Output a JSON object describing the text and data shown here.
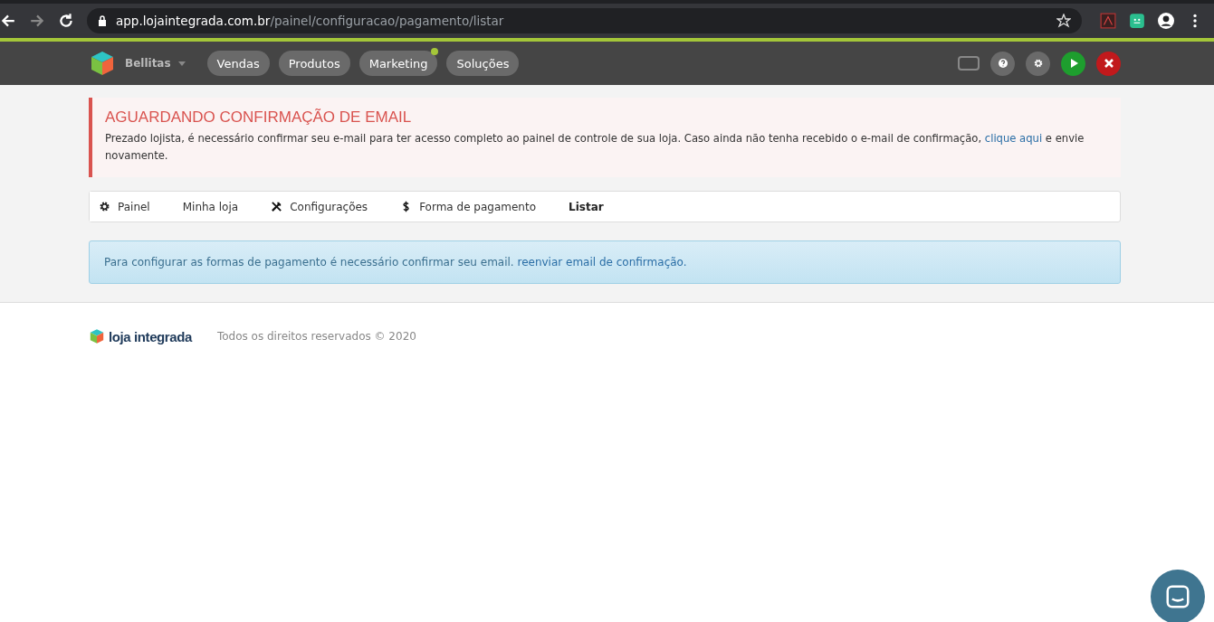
{
  "browser": {
    "url_host": "app.lojaintegrada.com.br",
    "url_path": "/painel/configuracao/pagamento/listar"
  },
  "header": {
    "store_name": "Bellitas",
    "nav": [
      {
        "label": "Vendas",
        "notification": false
      },
      {
        "label": "Produtos",
        "notification": false
      },
      {
        "label": "Marketing",
        "notification": true
      },
      {
        "label": "Soluções",
        "notification": false
      }
    ],
    "actions": [
      {
        "kind": "screen"
      },
      {
        "kind": "help"
      },
      {
        "kind": "settings"
      },
      {
        "kind": "play"
      },
      {
        "kind": "close"
      }
    ]
  },
  "alert": {
    "title": "AGUARDANDO CONFIRMAÇÃO DE EMAIL",
    "text": "Prezado lojista, é necessário confirmar seu e-mail para ter acesso completo ao painel de controle de sua loja. Caso ainda não tenha recebido o e-mail de confirmação,",
    "link": "clique aqui",
    "text_after": "e envie novamente."
  },
  "breadcrumbs": [
    {
      "label": "Painel",
      "kind": "home",
      "current": false
    },
    {
      "label": "Minha loja",
      "kind": "plain",
      "current": false
    },
    {
      "label": "Configurações",
      "kind": "settings",
      "current": false
    },
    {
      "label": "Forma de pagamento",
      "kind": "payment",
      "current": false
    },
    {
      "label": "Listar",
      "kind": "plain",
      "current": true
    }
  ],
  "info": {
    "text": "Para configurar as formas de pagamento é necessário confirmar seu email.",
    "link": "reenviar email de confirmação."
  },
  "footer": {
    "logo": "loja integrada",
    "copyright": "Todos os direitos reservados © 2020"
  }
}
